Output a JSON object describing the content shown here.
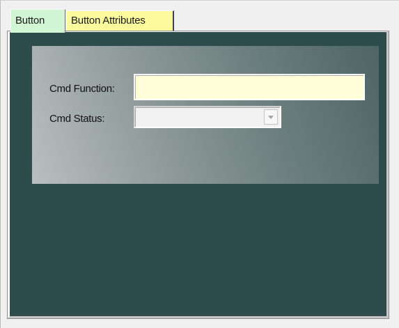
{
  "tabs": [
    {
      "label": "Button",
      "color": "#d2f5d4",
      "selected": true
    },
    {
      "label": "Button Attributes",
      "color": "#fbfb9e",
      "selected": false
    }
  ],
  "form": {
    "cmd_function_label": "Cmd Function:",
    "cmd_function_value": "",
    "cmd_function_bg": "#fffed8",
    "cmd_status_label": "Cmd Status:",
    "cmd_status_value": "",
    "cmd_status_disabled": true,
    "dropdown_icon": "chevron-down-icon"
  },
  "colors": {
    "panel_bg": "#2e4c4c",
    "group_gradient_dark": "#4e6564",
    "group_gradient_light": "#b8c0bf"
  }
}
